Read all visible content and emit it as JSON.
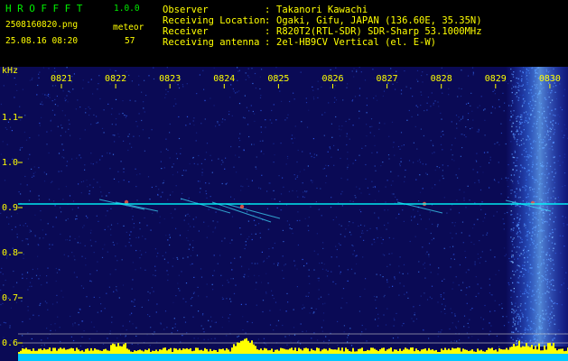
{
  "header": {
    "app_name": "HROFFFT",
    "app_version": "1.0.0",
    "filename": "2508160820.png",
    "datetime": "25.08.16 08:20",
    "meteor_label": "meteor",
    "meteor_count": "57",
    "info": [
      {
        "key": "Observer",
        "sep": ":",
        "value": "Takanori Kawachi"
      },
      {
        "key": "Receiving Location",
        "sep": ":",
        "value": "Ogaki, Gifu, JAPAN (136.60E, 35.35N)"
      },
      {
        "key": "Receiver",
        "sep": ":",
        "value": "R820T2(RTL-SDR) SDR-Sharp 53.1000MHz"
      },
      {
        "key": "Receiving antenna",
        "sep": ":",
        "value": "2el-HB9CV Vertical (el. E-W)"
      }
    ]
  },
  "spectrogram": {
    "y_unit": "kHz",
    "y_ticks": [
      "1.1",
      "1.0",
      "0.9",
      "0.8",
      "0.7",
      "0.6"
    ],
    "x_ticks": [
      "0821",
      "0822",
      "0823",
      "0824",
      "0825",
      "0826",
      "0827",
      "0828",
      "0829",
      "0830"
    ],
    "carrier_khz": 0.91,
    "y_range_khz": [
      0.58,
      1.19
    ],
    "colors": {
      "background": "#0a0a5a",
      "trace": "#00ffff",
      "histogram": "#ffff00",
      "grid": "#c0c0c0",
      "tick_text": "#ffff00"
    }
  }
}
